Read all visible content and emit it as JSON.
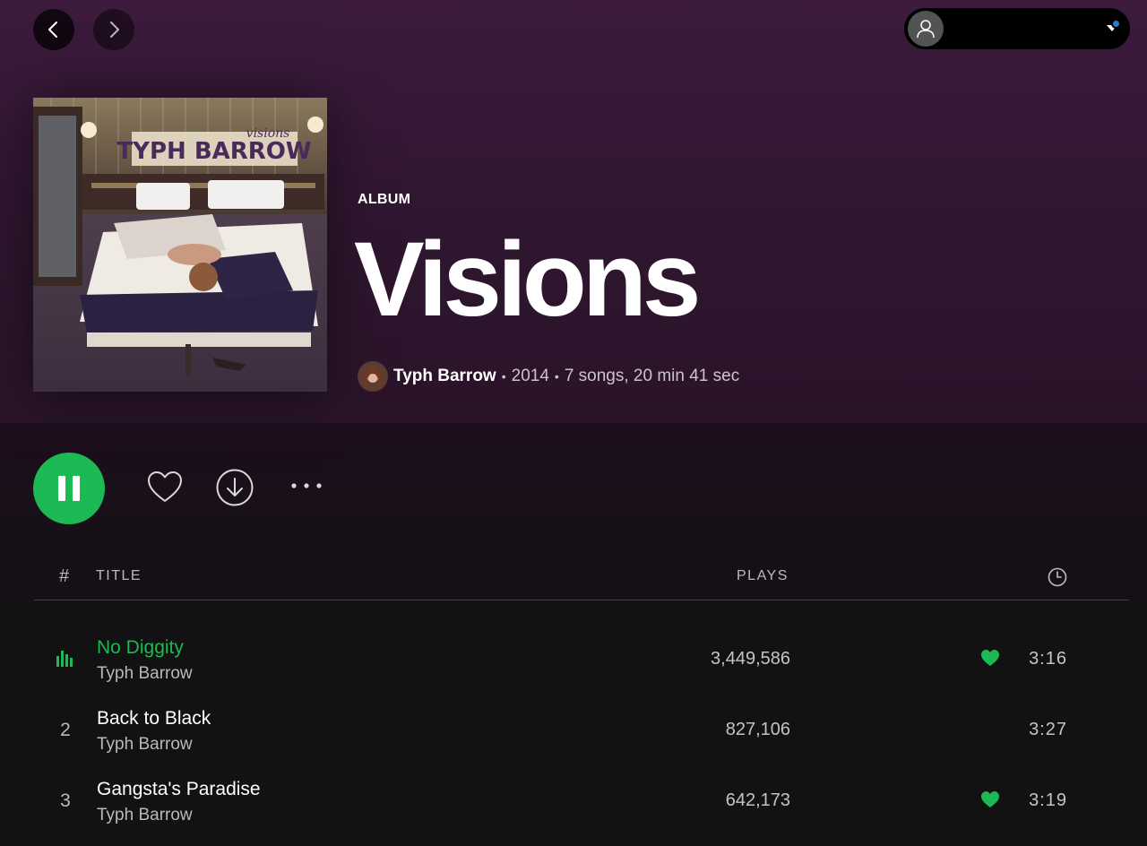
{
  "header": {
    "back_icon": "chevron-left-icon",
    "forward_icon": "chevron-right-icon",
    "user_icon": "user-icon",
    "dropdown_icon": "caret-down-icon"
  },
  "album": {
    "type_label": "ALBUM",
    "title": "Visions",
    "artist": "Typh Barrow",
    "year": "2014",
    "songs_info": "7 songs, 20 min 41 sec",
    "separator": "•",
    "cover_text_artist": "TYPH BARROW",
    "cover_text_title": "visions"
  },
  "actions": {
    "play_state": "playing",
    "icons": [
      "pause-icon",
      "heart-outline-icon",
      "download-icon",
      "more-icon"
    ]
  },
  "table": {
    "col_number": "#",
    "col_title": "TITLE",
    "col_plays": "PLAYS",
    "col_duration_icon": "clock-icon",
    "rows": [
      {
        "index": "1",
        "title": "No Diggity",
        "artist": "Typh Barrow",
        "plays": "3,449,586",
        "duration": "3:16",
        "liked": true,
        "playing": true
      },
      {
        "index": "2",
        "title": "Back to Black",
        "artist": "Typh Barrow",
        "plays": "827,106",
        "duration": "3:27",
        "liked": false,
        "playing": false
      },
      {
        "index": "3",
        "title": "Gangsta's Paradise",
        "artist": "Typh Barrow",
        "plays": "642,173",
        "duration": "3:19",
        "liked": true,
        "playing": false
      }
    ]
  },
  "colors": {
    "accent": "#1db954",
    "hero_background": "#3c1b3c",
    "page_background": "#121212",
    "notification_dot": "#2e77d0"
  }
}
